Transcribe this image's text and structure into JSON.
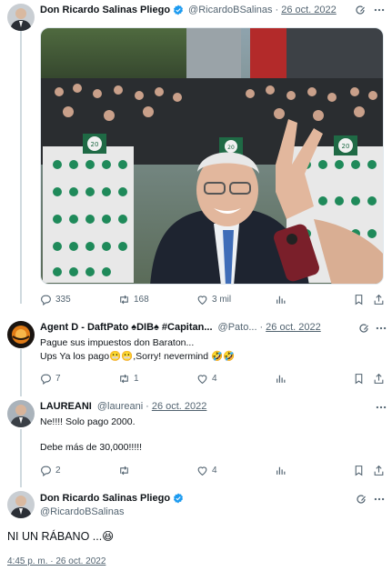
{
  "tweet_main": {
    "name": "Don Ricardo Salinas Pliego",
    "handle": "@RicardoBSalinas",
    "separator": "·",
    "date": "26 oct. 2022",
    "image_texts": {
      "sign_1": "20",
      "sign_2": "20",
      "sign_3": "20"
    },
    "actions": {
      "replies": "335",
      "retweets": "168",
      "likes": "3 mil"
    }
  },
  "reply_1": {
    "name": "Agent D - DaftPato ♠DIB♠ #Capitan...",
    "handle": "@Pato...",
    "separator": "·",
    "date": "26 oct. 2022",
    "line_1": "Pague sus impuestos don Baraton...",
    "line_2": "Ups Ya los pago😬😬,Sorry! nevermind 🤣🤣",
    "actions": {
      "replies": "7",
      "retweets": "1",
      "likes": "4"
    }
  },
  "reply_2": {
    "name": "LAUREANI",
    "handle": "@laureani",
    "separator": "·",
    "date": "26 oct. 2022",
    "line_1": "Ne!!!! Solo pago 2000.",
    "line_2": "Debe más de 30,000!!!!!",
    "actions": {
      "replies": "2",
      "retweets": "",
      "likes": "4"
    }
  },
  "tweet_focus": {
    "name": "Don Ricardo Salinas Pliego",
    "handle": "@RicardoBSalinas",
    "text": "NI UN RÁBANO ...😆",
    "timestamp": "4:45 p. m. · 26 oct. 2022"
  },
  "colors": {
    "text": "#0f1419",
    "muted": "#536471",
    "verified": "#1d9bf0",
    "thread": "#cfd9de"
  }
}
